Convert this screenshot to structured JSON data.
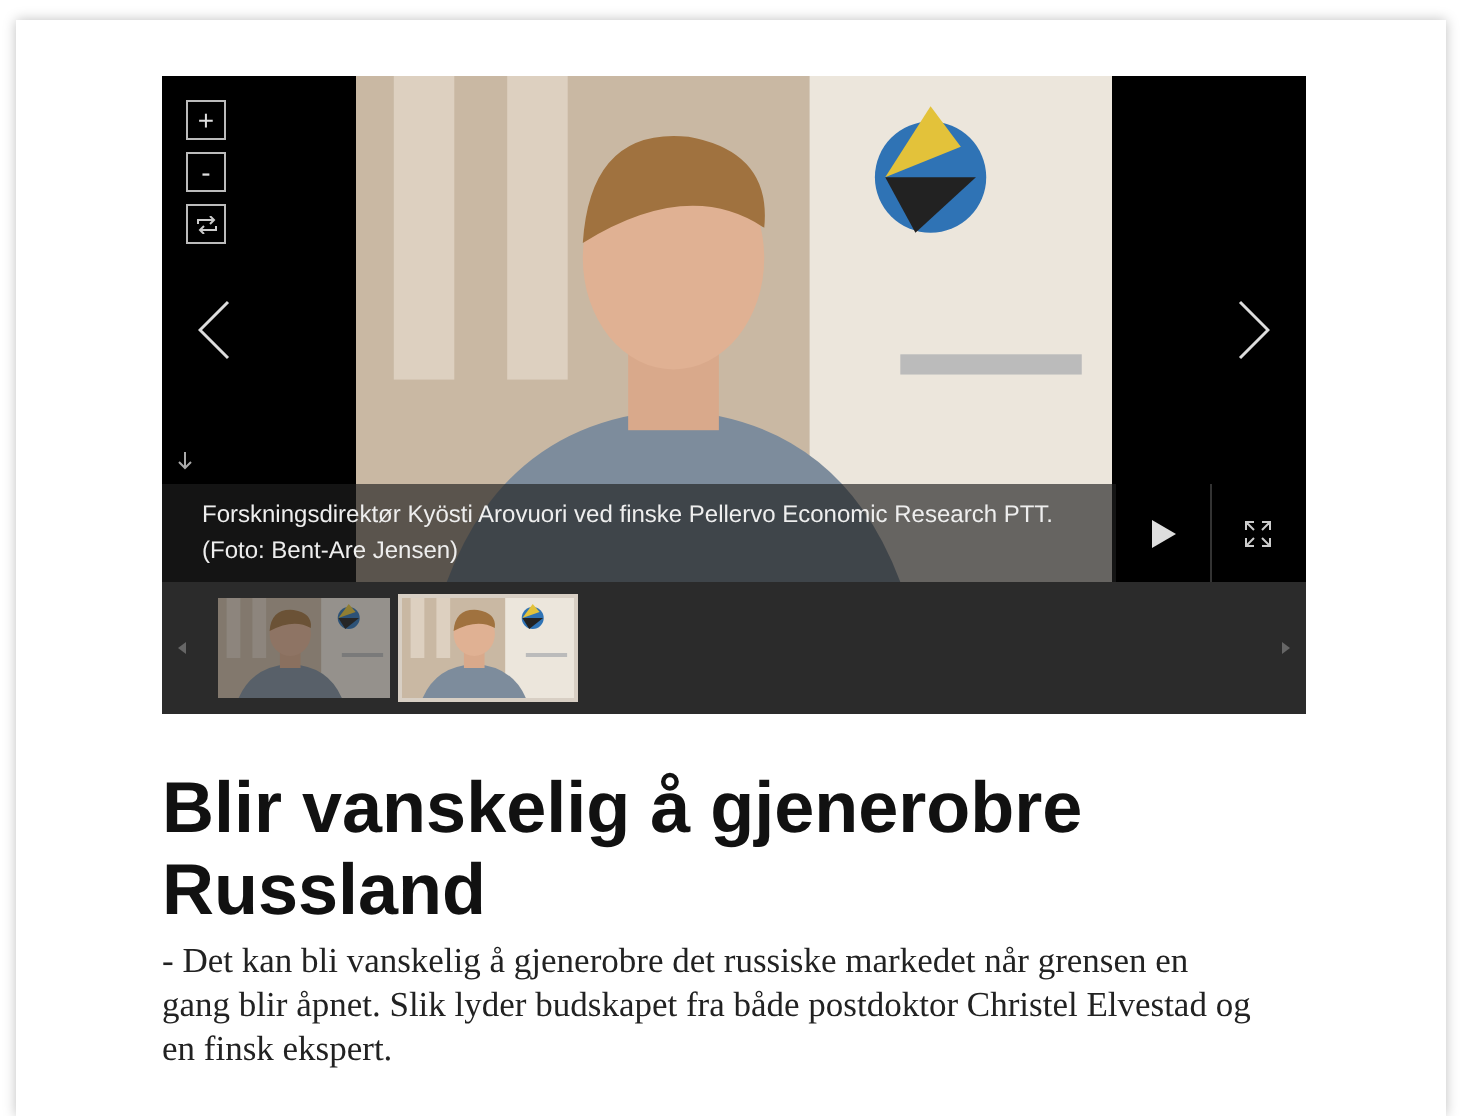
{
  "gallery": {
    "zoom_controls": [
      {
        "kind": "zoom-in",
        "label": "+"
      },
      {
        "kind": "zoom-out",
        "label": "-"
      },
      {
        "kind": "reset"
      }
    ],
    "caption": "Forskningsdirektør Kyösti Arovuori ved finske Pellervo Economic Research PTT. (Foto: Bent-Are Jensen)",
    "slide": {
      "kind": "picture"
    },
    "thumbnails": [
      {
        "kind": "picture",
        "selected": false
      },
      {
        "kind": "picture",
        "selected": true
      }
    ]
  },
  "article": {
    "title": "Blir vanskelig å gjenerobre Russland",
    "lede": "- Det kan bli vanskelig å gjenerobre det russiske markedet når grensen en gang blir åpnet. Slik lyder budskapet fra både postdoktor Christel Elvestad og en finsk ekspert."
  }
}
